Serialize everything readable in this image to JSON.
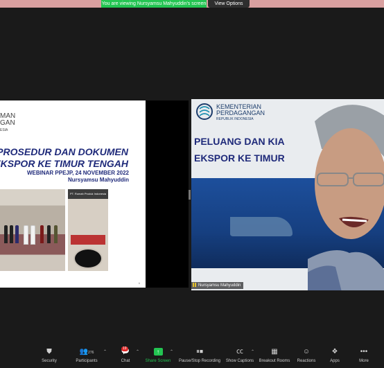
{
  "banner": {
    "viewing_text": "You are viewing Nursyamsu Mahyuddin's screen",
    "view_options": "View Options"
  },
  "slide": {
    "logo_line1": "MAN",
    "logo_line2": "GAN",
    "logo_line3": "ESIA",
    "title_line1": "PROSEDUR DAN DOKUMEN",
    "title_line2": "EKSPOR KE TIMUR TENGAH",
    "subtitle": "WEBINAR PPEJP, 24 NOVEMBER 2022",
    "presenter": "Nursyamsu Mahyuddin",
    "photo_banner": "PT. Rumah Produk Indonesia",
    "page_no": "6"
  },
  "video": {
    "ministry_line1": "KEMENTERIAN",
    "ministry_line2": "PERDAGANGAN",
    "ministry_line3": "REPUBLIK INDONESIA",
    "bg_line1": "PELUANG DAN KIA",
    "bg_line2": "EKSPOR KE TIMUR",
    "participant_name": "Nursyamsu Mahyuddin"
  },
  "toolbar": {
    "security": "Security",
    "participants": "Participants",
    "participants_count": "276",
    "chat": "Chat",
    "chat_badge": "19",
    "share_screen": "Share Screen",
    "pause_recording": "Pause/Stop Recording",
    "show_captions": "Show Captions",
    "breakout_rooms": "Breakout Rooms",
    "reactions": "Reactions",
    "apps": "Apps",
    "more": "More"
  },
  "colors": {
    "share_green": "#23c552",
    "banner_pink": "#d9a0a0",
    "slide_blue": "#1f2a7a",
    "badge_red": "#e02828"
  }
}
